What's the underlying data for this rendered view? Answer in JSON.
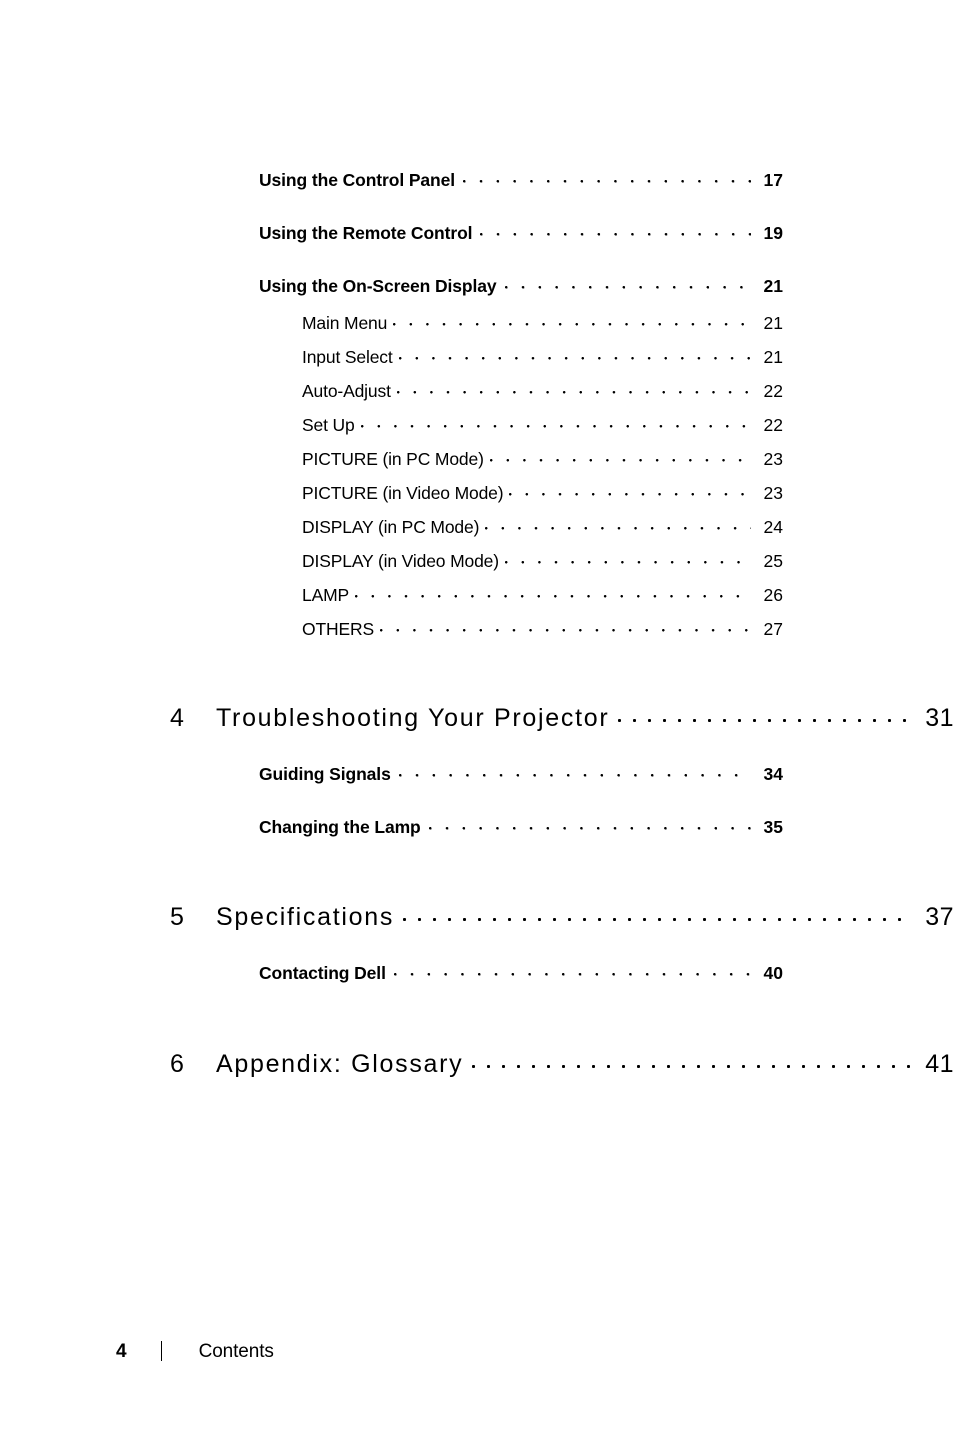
{
  "document": {
    "page_label": "Contents",
    "page_number": "4"
  },
  "toc": {
    "top_sections": [
      {
        "title": "Using the Control Panel",
        "page": "17"
      },
      {
        "title": "Using the Remote Control",
        "page": "19"
      },
      {
        "title": "Using the On-Screen Display",
        "page": "21"
      }
    ],
    "osd_subentries": [
      {
        "title": "Main Menu",
        "page": "21"
      },
      {
        "title": "Input Select",
        "page": "21"
      },
      {
        "title": "Auto-Adjust",
        "page": "22"
      },
      {
        "title": "Set Up",
        "page": "22"
      },
      {
        "title": "PICTURE (in PC Mode)",
        "page": "23"
      },
      {
        "title": "PICTURE (in Video Mode)",
        "page": "23"
      },
      {
        "title": "DISPLAY (in PC Mode)",
        "page": "24"
      },
      {
        "title": "DISPLAY (in Video Mode)",
        "page": "25"
      },
      {
        "title": "LAMP",
        "page": "26"
      },
      {
        "title": "OTHERS",
        "page": "27"
      }
    ],
    "chapters": [
      {
        "number": "4",
        "title": "Troubleshooting Your Projector",
        "page": "31",
        "sections": [
          {
            "title": "Guiding Signals",
            "page": "34"
          },
          {
            "title": "Changing the Lamp",
            "page": "35"
          }
        ]
      },
      {
        "number": "5",
        "title": "Specifications",
        "page": "37",
        "sections": [
          {
            "title": "Contacting Dell",
            "page": "40"
          }
        ]
      },
      {
        "number": "6",
        "title": "Appendix: Glossary",
        "page": "41",
        "sections": []
      }
    ]
  }
}
